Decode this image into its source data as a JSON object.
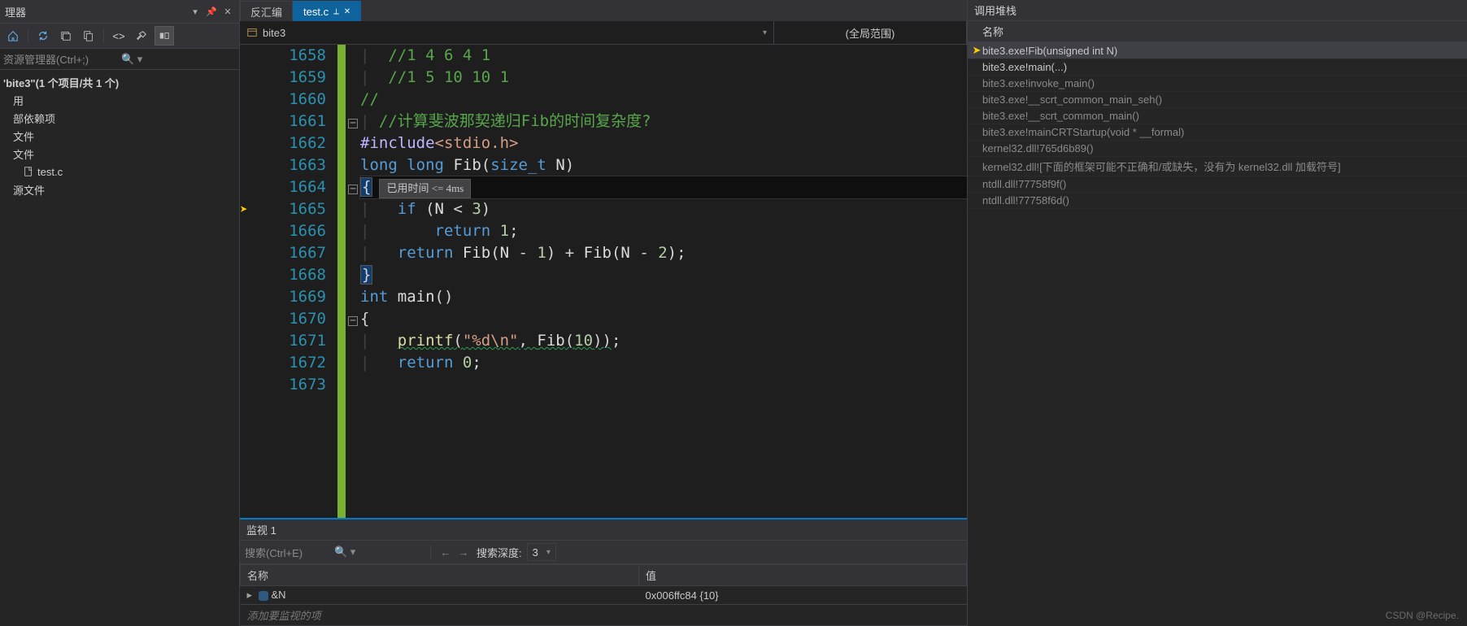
{
  "left": {
    "panel_title": "理器",
    "search_placeholder": "资源管理器(Ctrl+;)",
    "solution_line": "'bite3\"(1 个项目/共 1 个)",
    "tree": [
      {
        "label": "用",
        "indent": 1
      },
      {
        "label": "部依赖项",
        "indent": 1
      },
      {
        "label": "文件",
        "indent": 1
      },
      {
        "label": "文件",
        "indent": 1
      },
      {
        "label": "test.c",
        "indent": 2,
        "icon": true
      },
      {
        "label": "源文件",
        "indent": 1
      }
    ]
  },
  "tabs": {
    "t0": "反汇编",
    "t1": "test.c"
  },
  "nav": {
    "symbol": "bite3",
    "scope": "(全局范围)"
  },
  "code": {
    "lines": [
      {
        "n": "1658",
        "fold": "",
        "html": "<span class='guide'>|  </span><span class='tok-c'>//1 4 6 4 1</span>"
      },
      {
        "n": "1659",
        "fold": "",
        "html": "<span class='guide'>|  </span><span class='tok-c'>//1 5 10 10 1</span>"
      },
      {
        "n": "1660",
        "fold": "",
        "html": ""
      },
      {
        "n": "1661",
        "fold": "minus",
        "html": "<span class='tok-c'>//</span>"
      },
      {
        "n": "1662",
        "fold": "",
        "html": "<span class='guide'>| </span><span class='tok-c'>//计算斐波那契递归Fib的时间复杂度?</span>"
      },
      {
        "n": "1663",
        "fold": "",
        "html": "<span class='tok-m'>#include</span><span class='tok-s'>&lt;stdio.h&gt;</span>"
      },
      {
        "n": "1664",
        "fold": "minus",
        "html": "<span class='tok-k'>long</span> <span class='tok-k'>long</span> <span class='tok-id'>Fib</span>(<span class='tok-t'>size_t</span> <span class='tok-id'>N</span>)"
      },
      {
        "n": "1665",
        "fold": "",
        "cur": true,
        "html": "<span class='brace-hi'>{</span><span class='tooltip' data-name='perf-tooltip' data-interactable='false'>已用时间 &lt;= 4ms</span>"
      },
      {
        "n": "1666",
        "fold": "",
        "html": "<span class='guide'>|   </span><span class='tok-k'>if</span> (<span class='tok-id'>N</span> &lt; <span class='tok-n'>3</span>)"
      },
      {
        "n": "1667",
        "fold": "",
        "html": "<span class='guide'>|   </span>    <span class='tok-k'>return</span> <span class='tok-n'>1</span>;"
      },
      {
        "n": "1668",
        "fold": "",
        "html": "<span class='guide'>|   </span><span class='tok-k'>return</span> <span class='tok-id'>Fib</span>(<span class='tok-id'>N</span> - <span class='tok-n'>1</span>) + <span class='tok-id'>Fib</span>(<span class='tok-id'>N</span> - <span class='tok-n'>2</span>);"
      },
      {
        "n": "1669",
        "fold": "",
        "html": "<span class='brace-hi'>}</span>"
      },
      {
        "n": "1670",
        "fold": "minus",
        "html": "<span class='tok-k'>int</span> <span class='tok-id'>main</span>()"
      },
      {
        "n": "1671",
        "fold": "",
        "html": "{"
      },
      {
        "n": "1672",
        "fold": "",
        "html": "<span class='guide'>|   </span><span class='squiggle'><span class='tok-f'>printf</span>(<span class='tok-s'>\"%d\\n\"</span>, <span class='tok-id'>Fib</span>(<span class='tok-n'>10</span>))</span>;"
      },
      {
        "n": "1673",
        "fold": "",
        "html": "<span class='guide'>|   </span><span class='tok-k'>return</span> <span class='tok-n'>0</span>;"
      }
    ]
  },
  "watch": {
    "title": "监视 1",
    "search_placeholder": "搜索(Ctrl+E)",
    "depth_label": "搜索深度:",
    "depth_value": "3",
    "col_name": "名称",
    "col_value": "值",
    "rows": [
      {
        "name": "&N",
        "value": "0x006ffc84 {10}"
      }
    ],
    "add_placeholder": "添加要监视的项"
  },
  "callstack": {
    "title": "调用堆栈",
    "col_name": "名称",
    "frames": [
      {
        "text": "bite3.exe!Fib(unsigned int N)",
        "current": true,
        "selected": true
      },
      {
        "text": "bite3.exe!main(...)"
      },
      {
        "text": "bite3.exe!invoke_main()",
        "dim": true
      },
      {
        "text": "bite3.exe!__scrt_common_main_seh()",
        "dim": true
      },
      {
        "text": "bite3.exe!__scrt_common_main()",
        "dim": true
      },
      {
        "text": "bite3.exe!mainCRTStartup(void * __formal)",
        "dim": true
      },
      {
        "text": "kernel32.dll!765d6b89()",
        "dim": true
      },
      {
        "text": "kernel32.dll![下面的框架可能不正确和/或缺失，没有为 kernel32.dll 加载符号]",
        "dim": true
      },
      {
        "text": "ntdll.dll!77758f9f()",
        "dim": true
      },
      {
        "text": "ntdll.dll!77758f6d()",
        "dim": true
      }
    ]
  },
  "watermark": "CSDN @Recipe."
}
